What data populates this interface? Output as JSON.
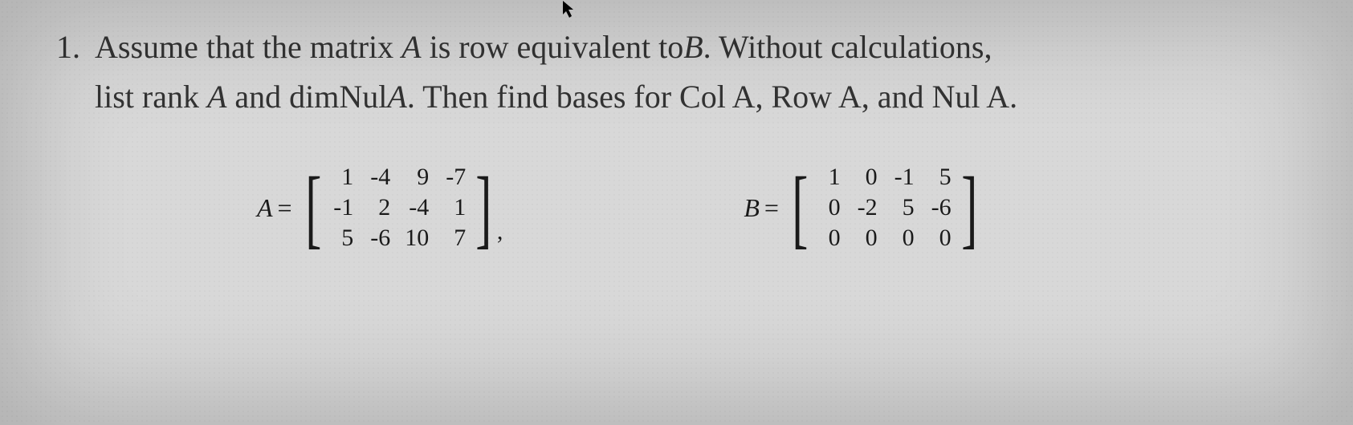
{
  "question": {
    "number": "1.",
    "line1_parts": {
      "p1": "Assume that the matrix ",
      "A1": "A",
      "p2": " is row equivalent to",
      "B1": "B",
      "p3": ". Without calculations,"
    },
    "line2_parts": {
      "p1": "list rank ",
      "A1": "A",
      "p2": " and dimNul",
      "A2": "A",
      "p3": ". Then find bases for Col A, Row A, and Nul A."
    }
  },
  "matrixA": {
    "label": "A",
    "eq": "=",
    "rows": [
      [
        "1",
        "-4",
        "9",
        "-7"
      ],
      [
        "-1",
        "2",
        "-4",
        "1"
      ],
      [
        "5",
        "-6",
        "10",
        "7"
      ]
    ],
    "trailing": ","
  },
  "matrixB": {
    "label": "B",
    "eq": "=",
    "rows": [
      [
        "1",
        "0",
        "-1",
        "5"
      ],
      [
        "0",
        "-2",
        "5",
        "-6"
      ],
      [
        "0",
        "0",
        "0",
        "0"
      ]
    ]
  }
}
